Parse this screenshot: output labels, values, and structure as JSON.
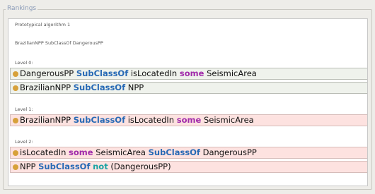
{
  "fieldset": {
    "title": "Rankings"
  },
  "header": {
    "line1": "Prototypical algorithm 1",
    "line2": "BrazilianNPP SubClassOf DangerousPP"
  },
  "levels": [
    {
      "label": "Level 0:",
      "rows": [
        {
          "status": "consistent",
          "parts": [
            "DangerousPP",
            "SubClassOf",
            "isLocatedIn",
            "some",
            "SeismicArea"
          ]
        },
        {
          "status": "consistent",
          "parts": [
            "BrazilianNPP",
            "SubClassOf",
            "NPP"
          ]
        }
      ]
    },
    {
      "label": "Level 1:",
      "rows": [
        {
          "status": "conflict",
          "parts": [
            "BrazilianNPP",
            "SubClassOf",
            "isLocatedIn",
            "some",
            "SeismicArea"
          ]
        }
      ]
    },
    {
      "label": "Level 2:",
      "rows": [
        {
          "status": "conflict",
          "parts": [
            "isLocatedIn",
            "some",
            "SeismicArea",
            "SubClassOf",
            "DangerousPP"
          ]
        },
        {
          "status": "conflict",
          "parts": [
            "NPP",
            "SubClassOf",
            "not",
            "(DangerousPP)"
          ]
        }
      ]
    }
  ],
  "colors": {
    "keyword_subclassof": "#2769b5",
    "keyword_some": "#a02aaa",
    "keyword_not": "#19a3a3",
    "bullet": "#d7a13a",
    "row_consistent_bg": "#eff2ec",
    "row_conflict_bg": "#fde2e0"
  }
}
